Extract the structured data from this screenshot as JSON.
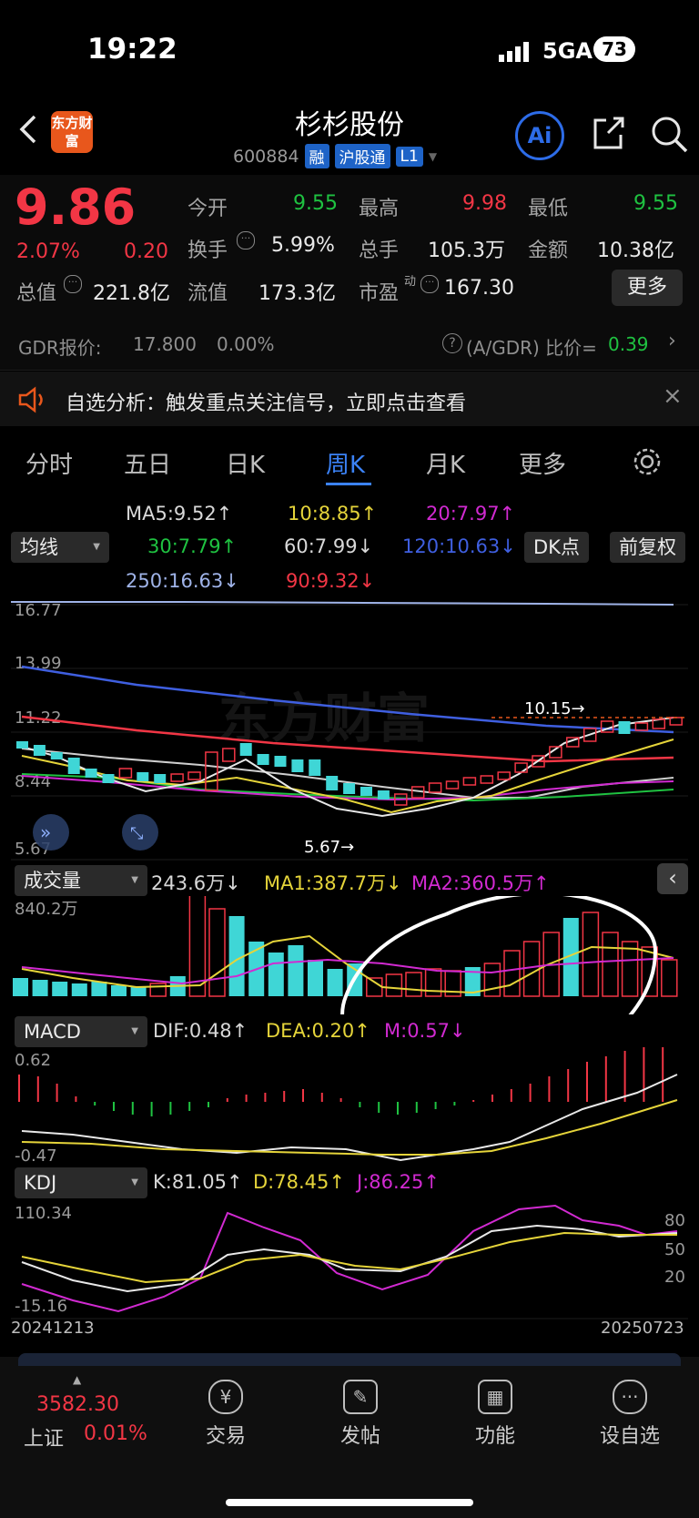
{
  "status_bar": {
    "time": "19:22",
    "network": "5GA",
    "battery": "73"
  },
  "header": {
    "title": "杉杉股份",
    "code": "600884",
    "tags": [
      "融",
      "沪股通",
      "L1"
    ],
    "logo_text": "东方财富",
    "ai_label": "Ai"
  },
  "quote": {
    "price": "9.86",
    "change_pct": "2.07%",
    "change": "0.20",
    "stats": {
      "open_label": "今开",
      "open": "9.55",
      "high_label": "最高",
      "high": "9.98",
      "low_label": "最低",
      "low": "9.55",
      "turnover_label": "换手",
      "turnover": "5.99%",
      "volume_label": "总手",
      "volume": "105.3万",
      "amount_label": "金额",
      "amount": "10.38亿",
      "mktcap_label": "总值",
      "mktcap": "221.8亿",
      "float_label": "流值",
      "float": "173.3亿",
      "pe_label": "市盈",
      "pe_super": "动",
      "pe": "167.30"
    },
    "more_label": "更多"
  },
  "gdr": {
    "label": "GDR报价:",
    "price": "17.800",
    "pct": "0.00%",
    "ratio_label": "(A/GDR) 比价=",
    "ratio": "0.39"
  },
  "alert": {
    "text": "自选分析：触发重点关注信号，立即点击查看"
  },
  "tabs": [
    "分时",
    "五日",
    "日K",
    "周K",
    "月K",
    "更多"
  ],
  "active_tab": "周K",
  "ma_panel": {
    "selector": "均线",
    "dk_label": "DK点",
    "adjust_label": "前复权",
    "items": [
      {
        "text": "MA5:9.52↑",
        "color": "#e8e8e8"
      },
      {
        "text": "10:8.85↑",
        "color": "#e5d43a"
      },
      {
        "text": "20:7.97↑",
        "color": "#d12ad1"
      },
      {
        "text": "30:7.79↑",
        "color": "#1fc241"
      },
      {
        "text": "60:7.99↓",
        "color": "#e8e8e8"
      },
      {
        "text": "120:10.63↓",
        "color": "#3f5fe0"
      },
      {
        "text": "250:16.63↓",
        "color": "#9fb3e8"
      },
      {
        "text": "90:9.32↓",
        "color": "#f23645"
      }
    ]
  },
  "kline": {
    "y_labels": [
      "16.77",
      "13.99",
      "11.22",
      "8.44",
      "5.67"
    ],
    "high_marker": "10.15→",
    "low_marker": "5.67→",
    "watermark": "东方财富"
  },
  "volume": {
    "selector": "成交量",
    "top_label": "840.2万",
    "legend": [
      {
        "text": "243.6万↓",
        "color": "#e8e8e8"
      },
      {
        "text": "MA1:387.7万↓",
        "color": "#e5d43a"
      },
      {
        "text": "MA2:360.5万↑",
        "color": "#d12ad1"
      }
    ]
  },
  "macd": {
    "selector": "MACD",
    "legend": [
      {
        "text": "DIF:0.48↑",
        "color": "#e8e8e8"
      },
      {
        "text": "DEA:0.20↑",
        "color": "#e5d43a"
      },
      {
        "text": "M:0.57↓",
        "color": "#d12ad1"
      }
    ],
    "y_top": "0.62",
    "y_bottom": "-0.47"
  },
  "kdj": {
    "selector": "KDJ",
    "legend": [
      {
        "text": "K:81.05↑",
        "color": "#e8e8e8"
      },
      {
        "text": "D:78.45↑",
        "color": "#e5d43a"
      },
      {
        "text": "J:86.25↑",
        "color": "#d12ad1"
      }
    ],
    "y_top": "110.34",
    "y_bottom": "-15.16",
    "levels": [
      "80",
      "50",
      "20"
    ]
  },
  "dates": {
    "start": "20241213",
    "end": "20250723"
  },
  "bottom_bar": {
    "index_value": "3582.30",
    "index_name": "上证",
    "index_pct": "0.01%",
    "nav": [
      {
        "label": "交易",
        "icon": "yen-exchange-icon"
      },
      {
        "label": "发帖",
        "icon": "edit-icon"
      },
      {
        "label": "功能",
        "icon": "grid-icon"
      },
      {
        "label": "设自选",
        "icon": "more-dots-icon"
      }
    ]
  }
}
